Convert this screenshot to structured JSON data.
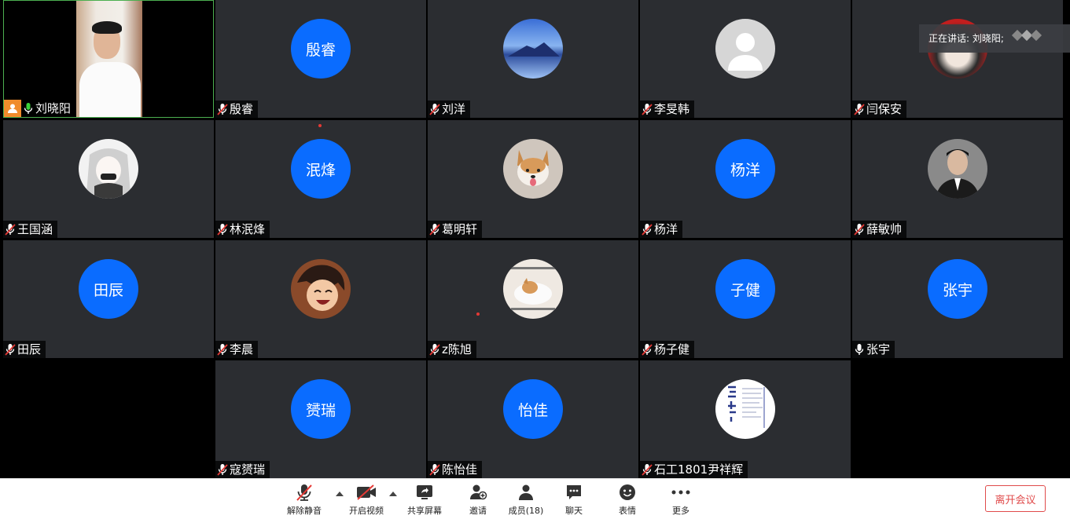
{
  "speaking_banner": "正在讲话: 刘晓阳;",
  "participants": [
    {
      "name": "刘晓阳",
      "avatar_text": "",
      "avatar": "video",
      "mic": "on",
      "host": true
    },
    {
      "name": "殷睿",
      "avatar_text": "殷睿",
      "avatar": "initials",
      "mic": "muted"
    },
    {
      "name": "刘洋",
      "avatar_text": "",
      "avatar": "mountain-photo-icon",
      "mic": "muted"
    },
    {
      "name": "李旻韩",
      "avatar_text": "",
      "avatar": "default-person-icon",
      "mic": "muted"
    },
    {
      "name": "闫保安",
      "avatar_text": "",
      "avatar": "red-photo-icon",
      "mic": "muted"
    },
    {
      "name": "王国涵",
      "avatar_text": "",
      "avatar": "anime-girl-photo-icon",
      "mic": "muted"
    },
    {
      "name": "林泯烽",
      "avatar_text": "泯烽",
      "avatar": "initials",
      "mic": "muted"
    },
    {
      "name": "葛明轩",
      "avatar_text": "",
      "avatar": "corgi-photo-icon",
      "mic": "muted"
    },
    {
      "name": "杨洋",
      "avatar_text": "杨洋",
      "avatar": "initials",
      "mic": "muted"
    },
    {
      "name": "薛敏帅",
      "avatar_text": "",
      "avatar": "man-portrait-photo-icon",
      "mic": "muted"
    },
    {
      "name": "田辰",
      "avatar_text": "田辰",
      "avatar": "initials",
      "mic": "muted"
    },
    {
      "name": "李晨",
      "avatar_text": "",
      "avatar": "anime-boy-photo-icon",
      "mic": "muted"
    },
    {
      "name": "z陈旭",
      "avatar_text": "",
      "avatar": "dog-meme-photo-icon",
      "mic": "muted"
    },
    {
      "name": "杨子健",
      "avatar_text": "子健",
      "avatar": "initials",
      "mic": "muted"
    },
    {
      "name": "张宇",
      "avatar_text": "张宇",
      "avatar": "initials",
      "mic": "on"
    },
    {
      "name": "寇赟瑞",
      "avatar_text": "赟瑞",
      "avatar": "initials",
      "mic": "muted"
    },
    {
      "name": "陈怡佳",
      "avatar_text": "怡佳",
      "avatar": "initials",
      "mic": "muted"
    },
    {
      "name": "石工1801尹祥辉",
      "avatar_text": "",
      "avatar": "calligraphy-photo-icon",
      "mic": "muted"
    }
  ],
  "toolbar": {
    "unmute": "解除静音",
    "start_video": "开启视频",
    "share_screen": "共享屏幕",
    "invite": "邀请",
    "members": "成员(18)",
    "chat": "聊天",
    "reactions": "表情",
    "more": "更多",
    "leave": "离开会议"
  },
  "colors": {
    "avatar_blue": "#0a6cff",
    "tile_bg": "#2b2d31",
    "leave_red": "#e04b4b",
    "host_orange": "#f08c2b"
  }
}
